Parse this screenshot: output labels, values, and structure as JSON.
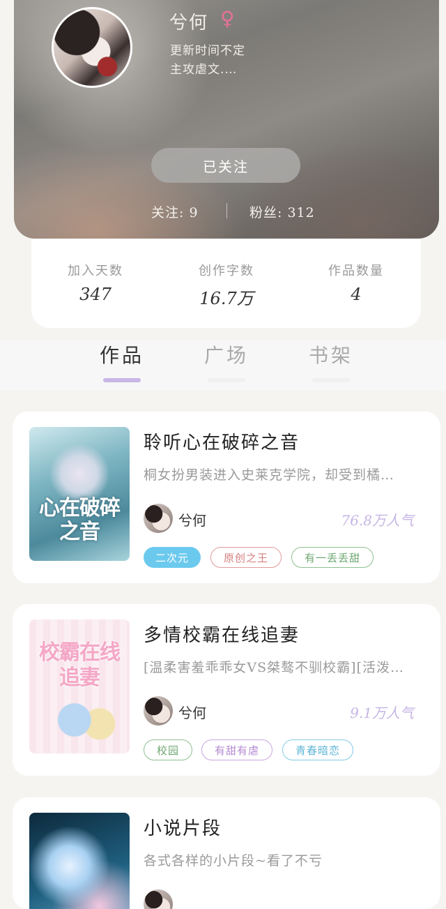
{
  "profile": {
    "name": "兮何",
    "gender_symbol": "♀",
    "bio_line1": "更新时间不定",
    "bio_line2": "主攻虐文.…",
    "follow_button": "已关注",
    "following": "关注: 9",
    "fans": "粉丝: 312"
  },
  "stats": [
    {
      "label": "加入天数",
      "value": "347"
    },
    {
      "label": "创作字数",
      "value": "16.7万"
    },
    {
      "label": "作品数量",
      "value": "4"
    }
  ],
  "tabs": [
    {
      "label": "作品",
      "active": true
    },
    {
      "label": "广场",
      "active": false
    },
    {
      "label": "书架",
      "active": false
    }
  ],
  "works": [
    {
      "title": "聆听心在破碎之音",
      "description": "桐女扮男装进入史莱克学院，却受到橘…",
      "author": "兮何",
      "popularity": "76.8万人气",
      "cover_text": "心在破碎之音",
      "tags": [
        {
          "label": "二次元",
          "style": "filled",
          "color": "#6cc9ee"
        },
        {
          "label": "原创之王",
          "style": "outline",
          "color": "#e29a9a"
        },
        {
          "label": "有一丢丢甜",
          "style": "outline",
          "color": "#8dbf8f"
        }
      ]
    },
    {
      "title": "多情校霸在线追妻",
      "description": "[温柔害羞乖乖女VS桀骜不驯校霸][活泼…",
      "author": "兮何",
      "popularity": "9.1万人气",
      "cover_text": "校霸在线追妻",
      "tags": [
        {
          "label": "校园",
          "style": "outline",
          "color": "#8dbf8f"
        },
        {
          "label": "有甜有虐",
          "style": "outline",
          "color": "#c8a5e0"
        },
        {
          "label": "青春暗恋",
          "style": "outline",
          "color": "#7fcbe6"
        }
      ]
    },
    {
      "title": "小说片段",
      "description": "各式各样的小片段~看了不亏",
      "author": "",
      "popularity": "",
      "cover_text": "",
      "tags": []
    }
  ]
}
